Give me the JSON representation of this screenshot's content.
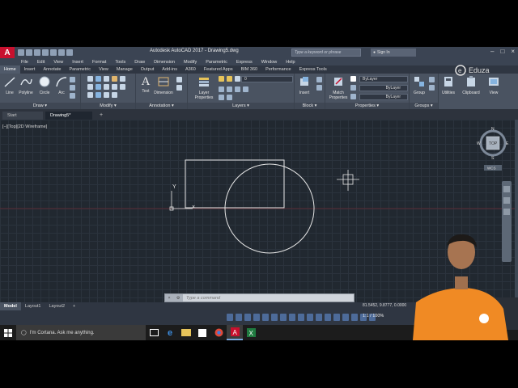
{
  "window": {
    "title": "Autodesk AutoCAD 2017  -  Drawing5.dwg",
    "search_placeholder": "Type a keyword or phrase",
    "signin_label": "Sign In"
  },
  "menu": [
    "File",
    "Edit",
    "View",
    "Insert",
    "Format",
    "Tools",
    "Draw",
    "Dimension",
    "Modify",
    "Parametric",
    "Express",
    "Window",
    "Help"
  ],
  "ribbon_tabs": [
    "Home",
    "Insert",
    "Annotate",
    "Parametric",
    "View",
    "Manage",
    "Output",
    "Add-ins",
    "A360",
    "Featured Apps",
    "BIM 360",
    "Performance",
    "Express Tools"
  ],
  "ribbon": {
    "draw": {
      "title": "Draw",
      "tools": [
        "Line",
        "Polyline",
        "Circle",
        "Arc"
      ]
    },
    "modify": {
      "title": "Modify"
    },
    "annotation": {
      "title": "Annotation",
      "tools": [
        "Text",
        "Dimension"
      ]
    },
    "layers": {
      "title": "Layers",
      "tool": "Layer Properties",
      "layer_value": "0"
    },
    "block": {
      "title": "Block",
      "tool": "Insert"
    },
    "properties": {
      "title": "Properties",
      "tool": "Match Properties",
      "bylayer_1": "ByLayer",
      "bylayer_2": "ByLayer",
      "bylayer_3": "ByLayer"
    },
    "groups": {
      "title": "Groups",
      "tool": "Group"
    },
    "utilities": {
      "tool": "Utilities"
    },
    "clipboard": {
      "tool": "Clipboard"
    },
    "view": {
      "tool": "View"
    }
  },
  "file_tabs": [
    "Start",
    "Drawing5*"
  ],
  "viewport_label": "[−][Top][2D Wireframe]",
  "viewcube": {
    "n": "N",
    "s": "S",
    "e": "E",
    "w": "W",
    "top": "TOP",
    "wcs": "WCS"
  },
  "ucs": {
    "y_label": "Y"
  },
  "command": {
    "placeholder": "Type a command"
  },
  "layout_tabs": [
    "Model",
    "Layout1",
    "Layout2"
  ],
  "status": {
    "coords": "81.5452, 9.8777, 0.0000",
    "zoom": "1:1 / 100%"
  },
  "taskbar": {
    "cortana": "I'm Cortana. Ask me anything."
  },
  "watermark": "Eduza"
}
